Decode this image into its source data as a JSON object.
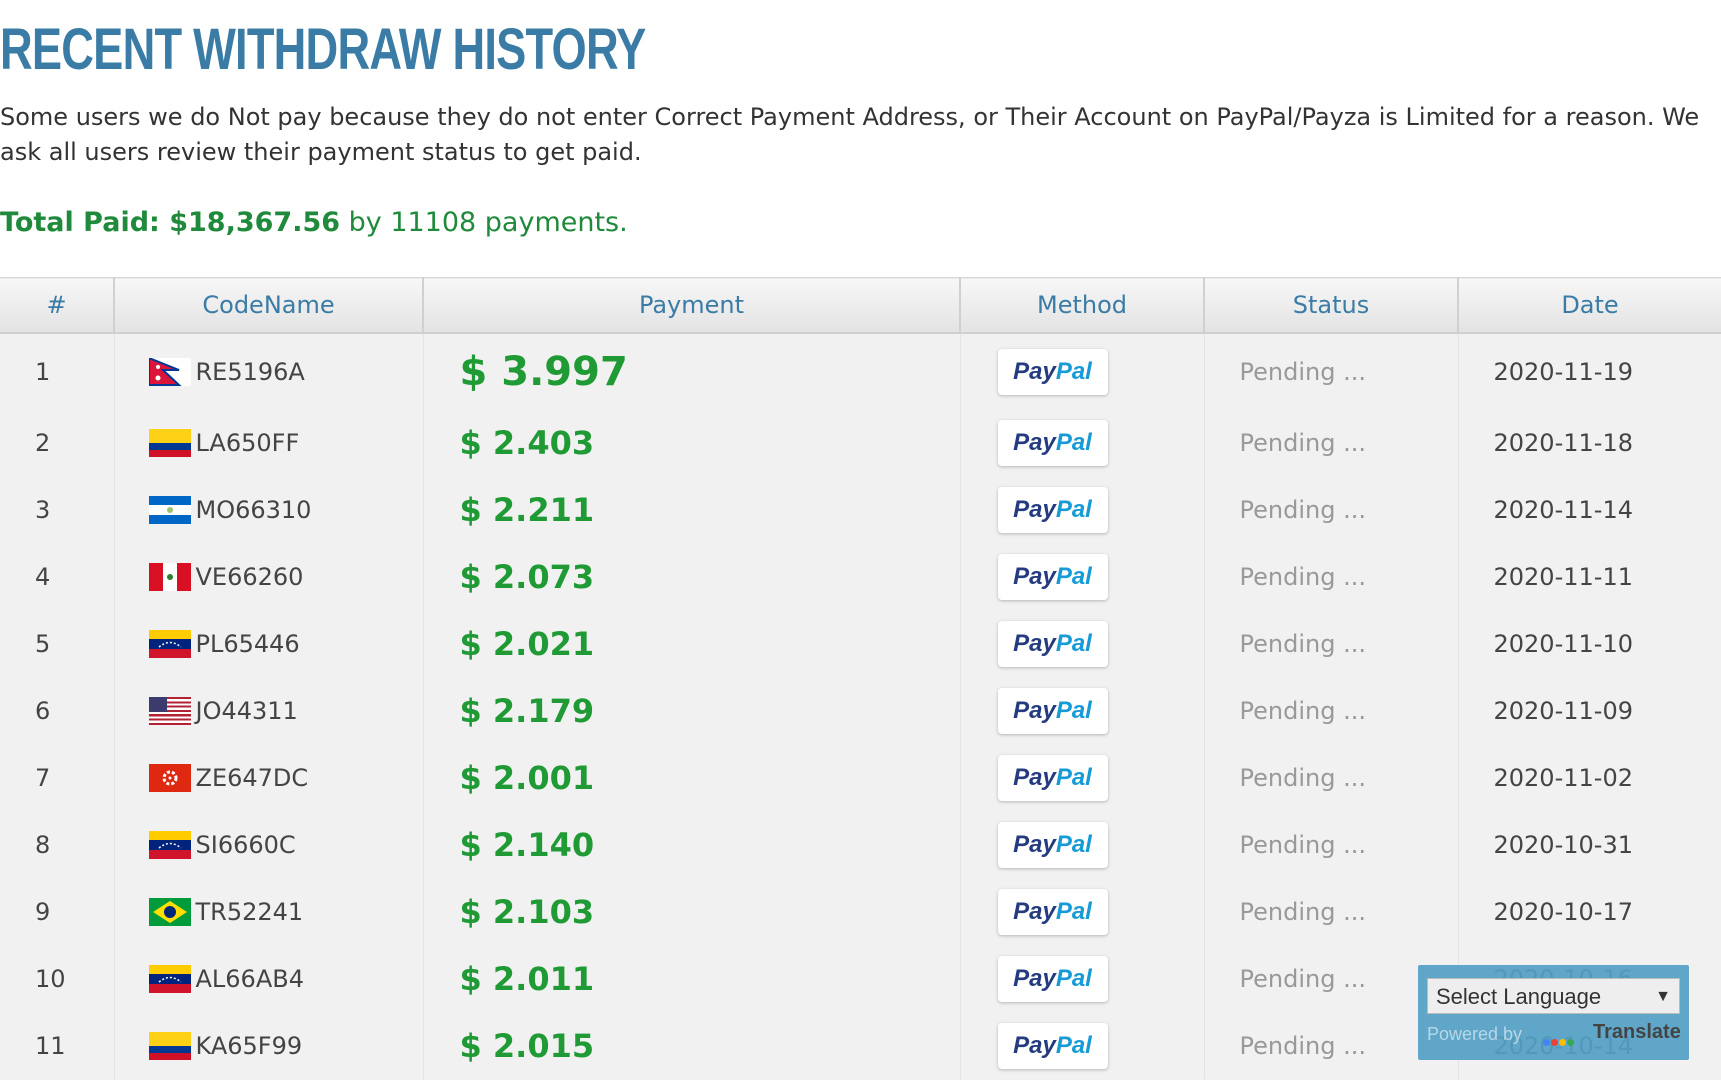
{
  "page": {
    "title": "RECENT WITHDRAW HISTORY",
    "intro": "Some users we do Not pay because they do not enter Correct Payment Address, or Their Account on PayPal/Payza is Limited for a reason. We ask all users review their payment status to get paid.",
    "total_label": "Total Paid: $18,367.56",
    "total_suffix": " by 11108 payments."
  },
  "table": {
    "headers": {
      "num": "#",
      "codename": "CodeName",
      "payment": "Payment",
      "method": "Method",
      "status": "Status",
      "date": "Date"
    },
    "rows": [
      {
        "num": "1",
        "flag": "flag-nepal",
        "code": "RE5196A",
        "amount": "$ 3.997",
        "method_a": "Pay",
        "method_b": "Pal",
        "status": "Pending ...",
        "date": "2020-11-19"
      },
      {
        "num": "2",
        "flag": "flag-colombia",
        "code": "LA650FF",
        "amount": "$ 2.403",
        "method_a": "Pay",
        "method_b": "Pal",
        "status": "Pending ...",
        "date": "2020-11-18"
      },
      {
        "num": "3",
        "flag": "flag-nicaragua",
        "code": "MO66310",
        "amount": "$ 2.211",
        "method_a": "Pay",
        "method_b": "Pal",
        "status": "Pending ...",
        "date": "2020-11-14"
      },
      {
        "num": "4",
        "flag": "flag-peru",
        "code": "VE66260",
        "amount": "$ 2.073",
        "method_a": "Pay",
        "method_b": "Pal",
        "status": "Pending ...",
        "date": "2020-11-11"
      },
      {
        "num": "5",
        "flag": "flag-venezuela",
        "code": "PL65446",
        "amount": "$ 2.021",
        "method_a": "Pay",
        "method_b": "Pal",
        "status": "Pending ...",
        "date": "2020-11-10"
      },
      {
        "num": "6",
        "flag": "flag-usa",
        "code": "JO44311",
        "amount": "$ 2.179",
        "method_a": "Pay",
        "method_b": "Pal",
        "status": "Pending ...",
        "date": "2020-11-09"
      },
      {
        "num": "7",
        "flag": "flag-hongkong",
        "code": "ZE647DC",
        "amount": "$ 2.001",
        "method_a": "Pay",
        "method_b": "Pal",
        "status": "Pending ...",
        "date": "2020-11-02"
      },
      {
        "num": "8",
        "flag": "flag-venezuela",
        "code": "SI6660C",
        "amount": "$ 2.140",
        "method_a": "Pay",
        "method_b": "Pal",
        "status": "Pending ...",
        "date": "2020-10-31"
      },
      {
        "num": "9",
        "flag": "flag-brazil",
        "code": "TR52241",
        "amount": "$ 2.103",
        "method_a": "Pay",
        "method_b": "Pal",
        "status": "Pending ...",
        "date": "2020-10-17"
      },
      {
        "num": "10",
        "flag": "flag-venezuela",
        "code": "AL66AB4",
        "amount": "$ 2.011",
        "method_a": "Pay",
        "method_b": "Pal",
        "status": "Pending ...",
        "date": "2020-10-16"
      },
      {
        "num": "11",
        "flag": "flag-colombia",
        "code": "KA65F99",
        "amount": "$ 2.015",
        "method_a": "Pay",
        "method_b": "Pal",
        "status": "Pending ...",
        "date": "2020-10-14"
      }
    ]
  },
  "translate": {
    "select_label": "Select Language",
    "powered_by": "Powered by",
    "translate_label": "Translate"
  },
  "colors": {
    "title": "#3a7ca5",
    "amount": "#1f9a35",
    "total": "#1f8a3b",
    "paypal_dark": "#253b80",
    "paypal_light": "#179bd7",
    "widget": "#52a0c4"
  }
}
